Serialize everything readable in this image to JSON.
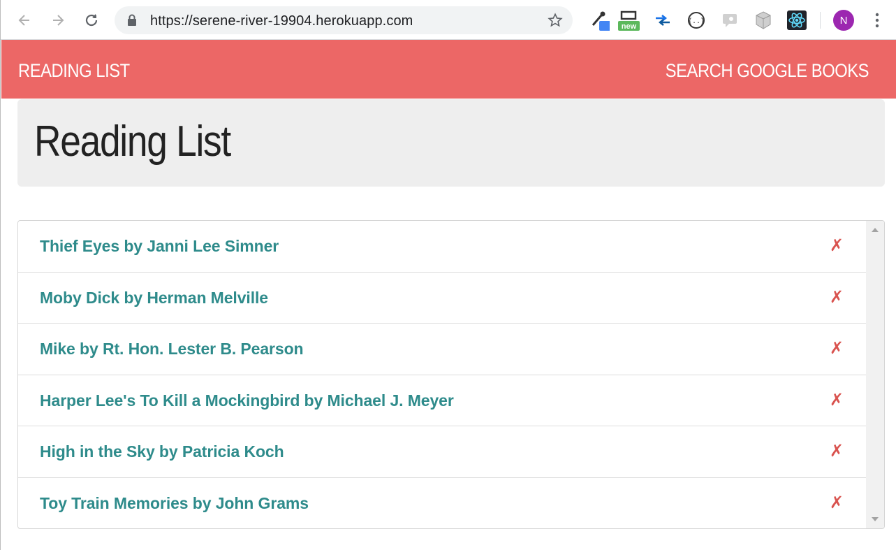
{
  "browser": {
    "url": "https://serene-river-19904.herokuapp.com",
    "extensions": [
      "eyedropper-icon",
      "screen-capture-icon",
      "arrows-icon",
      "json-viewer-icon",
      "chat-icon",
      "cube-icon",
      "react-devtools-icon"
    ],
    "extension_badge": "new",
    "avatar_initial": "N"
  },
  "navbar": {
    "brand": "READING LIST",
    "search_link": "SEARCH GOOGLE BOOKS",
    "color": "#ec6766"
  },
  "page": {
    "title": "Reading List"
  },
  "books": [
    {
      "label": "Thief Eyes by Janni Lee Simner",
      "delete": "✗"
    },
    {
      "label": "Moby Dick by Herman Melville",
      "delete": "✗"
    },
    {
      "label": "Mike by Rt. Hon. Lester B. Pearson",
      "delete": "✗"
    },
    {
      "label": "Harper Lee's To Kill a Mockingbird by Michael J. Meyer",
      "delete": "✗"
    },
    {
      "label": "High in the Sky by Patricia Koch",
      "delete": "✗"
    },
    {
      "label": "Toy Train Memories by John Grams",
      "delete": "✗"
    }
  ],
  "colors": {
    "link": "#2e8b8b",
    "delete": "#d9534f",
    "jumbotron": "#eeeeee"
  }
}
